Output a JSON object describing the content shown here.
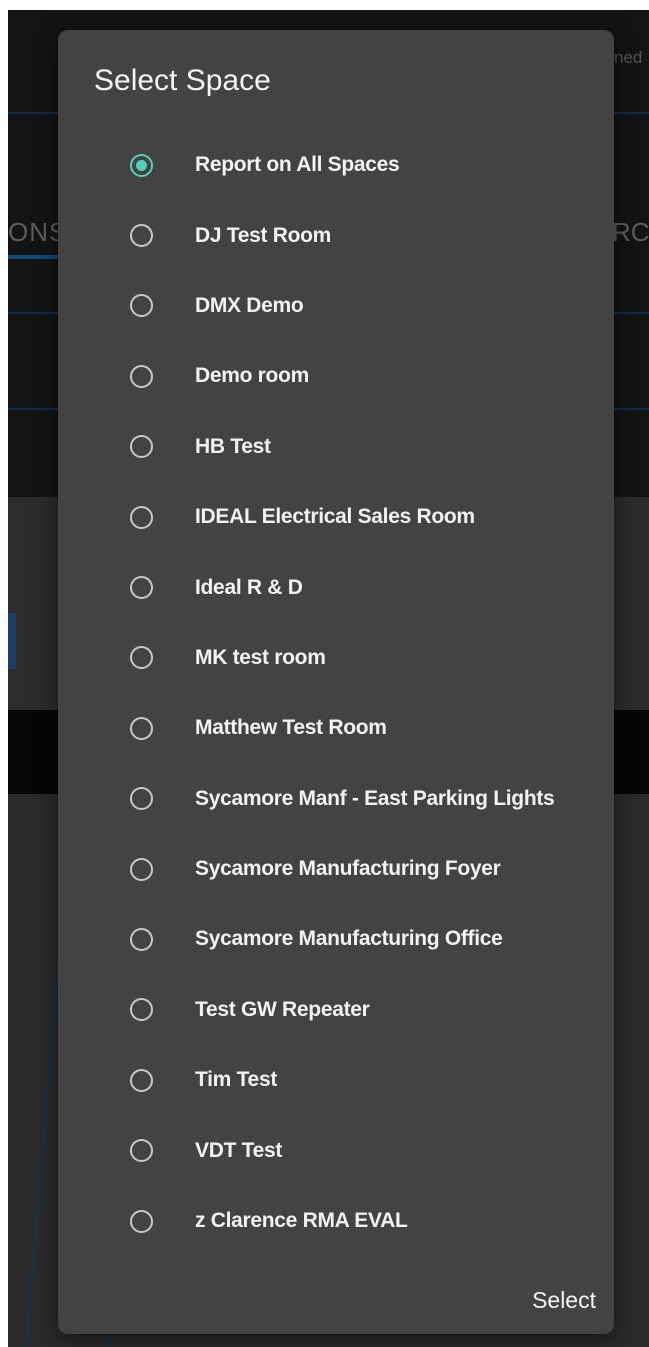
{
  "background": {
    "tab_left_text": "ONS",
    "tab_right_text": "RC",
    "top_right_text": "ned"
  },
  "dialog": {
    "title": "Select Space",
    "select_label": "Select",
    "selected_index": 0,
    "accent_color": "#53d3b5",
    "options": [
      {
        "label": "Report on All Spaces",
        "selected": true
      },
      {
        "label": "DJ Test Room",
        "selected": false
      },
      {
        "label": "DMX Demo",
        "selected": false
      },
      {
        "label": "Demo room",
        "selected": false
      },
      {
        "label": "HB Test",
        "selected": false
      },
      {
        "label": "IDEAL Electrical Sales Room",
        "selected": false
      },
      {
        "label": "Ideal R & D",
        "selected": false
      },
      {
        "label": "MK test room",
        "selected": false
      },
      {
        "label": "Matthew Test Room",
        "selected": false
      },
      {
        "label": "Sycamore Manf - East Parking Lights",
        "selected": false
      },
      {
        "label": "Sycamore Manufacturing Foyer",
        "selected": false
      },
      {
        "label": "Sycamore Manufacturing Office",
        "selected": false
      },
      {
        "label": "Test GW Repeater",
        "selected": false
      },
      {
        "label": "Tim Test",
        "selected": false
      },
      {
        "label": "VDT Test",
        "selected": false
      },
      {
        "label": "z Clarence RMA EVAL",
        "selected": false
      }
    ]
  }
}
